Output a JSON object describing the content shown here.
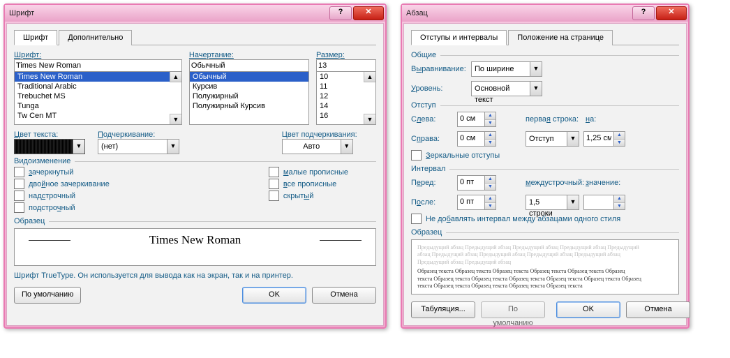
{
  "font": {
    "title": "Шрифт",
    "tab_font": "Шрифт",
    "tab_advanced": "Дополнительно",
    "lbl_font": "Шрифт:",
    "lbl_style": "Начертание:",
    "lbl_size": "Размер:",
    "font_value": "Times New Roman",
    "font_list": [
      "Times New Roman",
      "Traditional Arabic",
      "Trebuchet MS",
      "Tunga",
      "Tw Cen MT"
    ],
    "style_value": "Обычный",
    "style_list": [
      "Обычный",
      "Курсив",
      "Полужирный",
      "Полужирный Курсив"
    ],
    "size_value": "13",
    "size_list": [
      "10",
      "11",
      "12",
      "14",
      "16"
    ],
    "lbl_color": "Цвет текста:",
    "lbl_underline": "Подчеркивание:",
    "underline_value": "(нет)",
    "lbl_ucolor": "Цвет подчеркивания:",
    "ucolor_value": "Авто",
    "lbl_effects": "Видоизменение",
    "chk_strike": "зачеркнутый",
    "chk_dblstrike": "двойное зачеркивание",
    "chk_super": "надстрочный",
    "chk_sub": "подстрочный",
    "chk_smallcaps": "малые прописные",
    "chk_allcaps": "все прописные",
    "chk_hidden": "скрытый",
    "lbl_sample": "Образец",
    "sample_text": "Times New Roman",
    "hint": "Шрифт TrueType. Он используется для вывода как на экран, так и на принтер.",
    "btn_default": "По умолчанию",
    "btn_ok": "OK",
    "btn_cancel": "Отмена"
  },
  "para": {
    "title": "Абзац",
    "tab_indents": "Отступы и интервалы",
    "tab_position": "Положение на странице",
    "grp_general": "Общие",
    "lbl_align": "Выравнивание:",
    "align_value": "По ширине",
    "lbl_level": "Уровень:",
    "level_value": "Основной текст",
    "grp_indent": "Отступ",
    "lbl_left": "Слева:",
    "left_value": "0 см",
    "lbl_right": "Справа:",
    "right_value": "0 см",
    "lbl_firstline": "первая строка:",
    "firstline_value": "Отступ",
    "lbl_by": "на:",
    "by_value": "1,25 см",
    "chk_mirror": "Зеркальные отступы",
    "grp_interval": "Интервал",
    "lbl_before": "Перед:",
    "before_value": "0 пт",
    "lbl_after": "После:",
    "after_value": "0 пт",
    "lbl_linespacing": "междустрочный:",
    "linespacing_value": "1,5 строки",
    "lbl_at": "значение:",
    "at_value": "",
    "chk_noadd": "Не добавлять интервал между абзацами одного стиля",
    "lbl_sample": "Образец",
    "sample_lines": [
      "Предыдущий абзац Предыдущий абзац Предыдущий абзац Предыдущий абзац Предыдущий",
      "абзац Предыдущий абзац Предыдущий абзац Предыдущий абзац Предыдущий абзац",
      "Предыдущий абзац Предыдущий абзац",
      "Образец текста Образец текста Образец текста Образец текста Образец текста Образец",
      "текста Образец текста Образец текста Образец текста Образец текста Образец текста Образец",
      "текста Образец текста Образец текста Образец текста Образец текста"
    ],
    "btn_tabs": "Табуляция...",
    "btn_default": "По умолчанию",
    "btn_ok": "OK",
    "btn_cancel": "Отмена"
  }
}
